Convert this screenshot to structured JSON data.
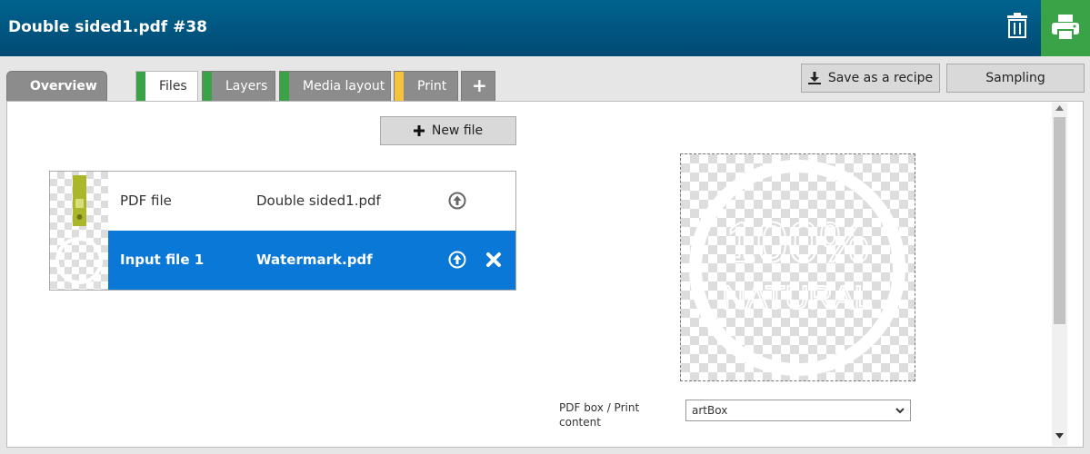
{
  "header": {
    "title": "Double sided1.pdf #38",
    "colors": {
      "bar": "#005b86",
      "print": "#3aa348"
    }
  },
  "tabs": [
    {
      "label": "Overview",
      "status": null
    },
    {
      "label": "Files",
      "status": "green",
      "active": true
    },
    {
      "label": "Layers",
      "status": "green"
    },
    {
      "label": "Media layout",
      "status": "green"
    },
    {
      "label": "Print",
      "status": "yellow"
    },
    {
      "label": "+",
      "status": null
    }
  ],
  "status_colors": {
    "green": "#3aa348",
    "yellow": "#f5c33b"
  },
  "toolbar": {
    "save_recipe_label": "Save as a recipe",
    "sampling_label": "Sampling",
    "new_file_label": "New file"
  },
  "files": [
    {
      "type": "PDF file",
      "name": "Double sided1.pdf",
      "selected": false,
      "removable": false
    },
    {
      "type": "Input file 1",
      "name": "Watermark.pdf",
      "selected": true,
      "removable": true
    }
  ],
  "preview": {
    "text_top": "100%",
    "text_bottom": "NATURAL"
  },
  "pdf_box": {
    "label": "PDF box / Print content",
    "value": "artBox"
  },
  "icons": [
    "trash-icon",
    "printer-icon",
    "download-icon",
    "plus-icon",
    "upload-icon",
    "close-icon",
    "chevron-down-icon"
  ]
}
